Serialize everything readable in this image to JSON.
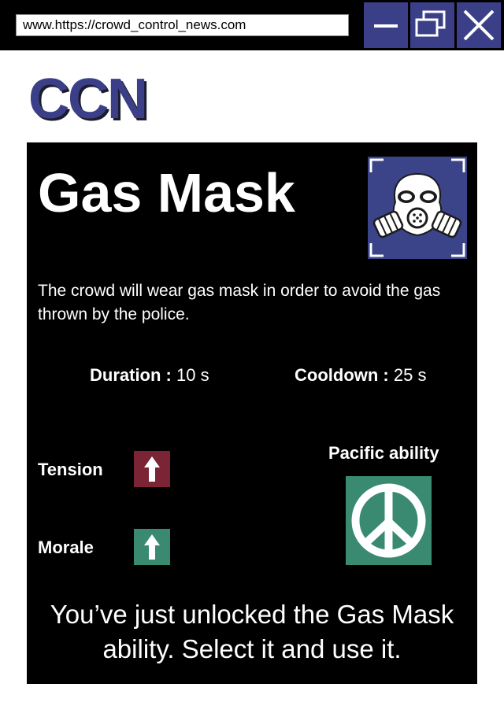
{
  "browser": {
    "url": "www.https://crowd_control_news.com",
    "buttons": {
      "minimize_icon": "minimize-icon",
      "maximize_icon": "restore-icon",
      "close_icon": "close-icon"
    },
    "button_color": "#3b3f88"
  },
  "site": {
    "logo_text": "CCN",
    "logo_color": "#3b3f88"
  },
  "ability": {
    "title": "Gas Mask",
    "icon": "gas-mask-icon",
    "description": "The crowd will wear gas mask in order to avoid the gas thrown by the police.",
    "duration_label": "Duration :",
    "duration_value": "10 s",
    "cooldown_label": "Cooldown :",
    "cooldown_value": "25 s",
    "effects": [
      {
        "label": "Tension",
        "direction": "up",
        "icon": "arrow-up-icon",
        "color": "#7a2435"
      },
      {
        "label": "Morale",
        "direction": "up",
        "icon": "arrow-up-icon",
        "color": "#3a8a72"
      }
    ],
    "type_label": "Pacific ability",
    "type_icon": "peace-icon",
    "type_color": "#3a8a72",
    "unlock_message": "You’ve just unlocked the Gas Mask ability. Select it and use it."
  }
}
